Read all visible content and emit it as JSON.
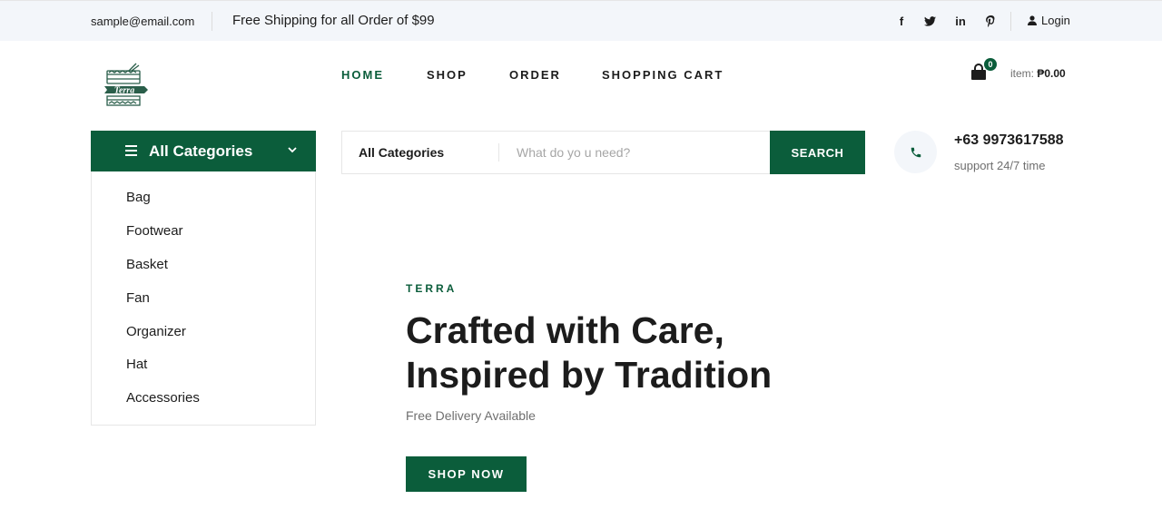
{
  "topbar": {
    "email": "sample@email.com",
    "shipping": "Free Shipping for all Order of $99",
    "social": [
      {
        "icon": "facebook-icon",
        "glyph": "f"
      },
      {
        "icon": "twitter-icon",
        "glyph": "t"
      },
      {
        "icon": "linkedin-icon",
        "glyph": "in"
      },
      {
        "icon": "pinterest-icon",
        "glyph": "p"
      }
    ],
    "login": "Login"
  },
  "nav": {
    "home": "HOME",
    "shop": "SHOP",
    "order": "ORDER",
    "cart": "SHOPPING CART"
  },
  "cart": {
    "count": "0",
    "item_label": "item:",
    "total": "₱0.00"
  },
  "categories": {
    "title": "All Categories",
    "items": [
      "Bag",
      "Footwear",
      "Basket",
      "Fan",
      "Organizer",
      "Hat",
      "Accessories"
    ]
  },
  "search": {
    "category": "All Categories",
    "placeholder": "What do yo u need?",
    "button": "SEARCH"
  },
  "contact": {
    "phone": "+63 9973617588",
    "support": "support 24/7 time"
  },
  "hero": {
    "tag": "TERRA",
    "title_line1": "Crafted with Care,",
    "title_line2": "Inspired by Tradition",
    "subtitle": "Free Delivery Available",
    "button": "SHOP NOW"
  },
  "colors": {
    "brand": "#0b5d3b",
    "topbar_bg": "#f3f6fa"
  }
}
